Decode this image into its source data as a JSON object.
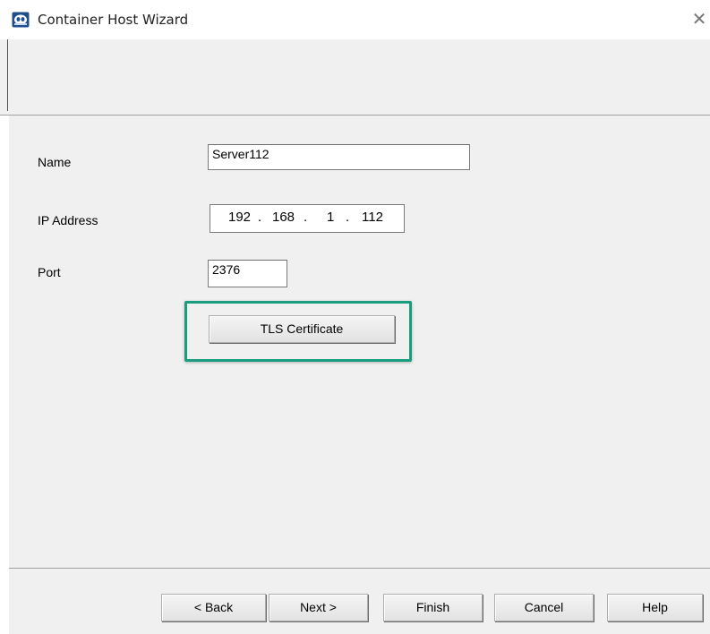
{
  "window": {
    "title": "Container Host Wizard",
    "close_symbol": "✕",
    "app_icon": "terminal-server-icon",
    "accent_color": "#1a9c7f"
  },
  "form": {
    "name_label": "Name",
    "name_value": "Server112",
    "ip_label": "IP Address",
    "ip_octets": [
      "192",
      "168",
      "1",
      "112"
    ],
    "ip_separator": ".",
    "port_label": "Port",
    "port_value": "2376",
    "tls_button_label": "TLS Certificate"
  },
  "footer": {
    "back_label": "< Back",
    "next_label": "Next >",
    "finish_label": "Finish",
    "cancel_label": "Cancel",
    "help_label": "Help"
  }
}
